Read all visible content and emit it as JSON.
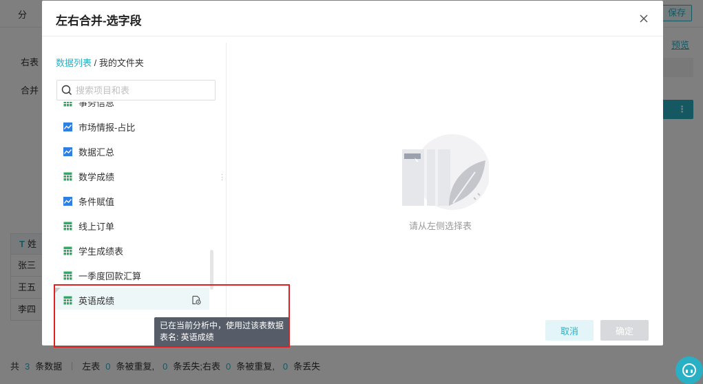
{
  "background": {
    "top_left": "分",
    "save_label": "保存",
    "preview_label": "预览",
    "right_table_label": "右表",
    "merge_label": "合并",
    "teal_menu": "⋮",
    "table": {
      "header": "姓",
      "header_type": "T",
      "rows": [
        "张三",
        "王五",
        "李四"
      ]
    },
    "footer": {
      "prefix": "共",
      "total": "3",
      "total_unit": "条数据",
      "left_table": "左表",
      "left_dup": "0",
      "dup_unit": "条被重复,",
      "left_lost": "0",
      "lost_unit": "条丢失;",
      "right_table": "右表",
      "right_dup": "0",
      "right_dup_unit": "条被重复,",
      "right_lost": "0",
      "right_lost_unit": "条丢失"
    }
  },
  "modal": {
    "title": "左右合并-选字段",
    "breadcrumb": {
      "root": "数据列表",
      "separator": " / ",
      "current": "我的文件夹"
    },
    "search": {
      "placeholder": "搜索项目和表",
      "value": ""
    },
    "items": [
      {
        "label": "事务信息",
        "type": "table"
      },
      {
        "label": "市场情报-占比",
        "type": "analysis"
      },
      {
        "label": "数据汇总",
        "type": "analysis"
      },
      {
        "label": "数学成绩",
        "type": "table"
      },
      {
        "label": "条件赋值",
        "type": "analysis"
      },
      {
        "label": "线上订单",
        "type": "table"
      },
      {
        "label": "学生成绩表",
        "type": "table"
      },
      {
        "label": "一季度回款汇算",
        "type": "table"
      },
      {
        "label": "英语成绩",
        "type": "table",
        "active": true
      }
    ],
    "empty_text": "请从左侧选择表",
    "cancel_label": "取消",
    "ok_label": "确定",
    "tooltip": {
      "line1": "已在当前分析中，使用过该表数据",
      "line2": "表名: 英语成绩"
    }
  },
  "colors": {
    "accent": "#2ab0c4",
    "table_icon": "#27ae60",
    "analysis_icon": "#2f7fe0",
    "highlight": "#e02020"
  }
}
